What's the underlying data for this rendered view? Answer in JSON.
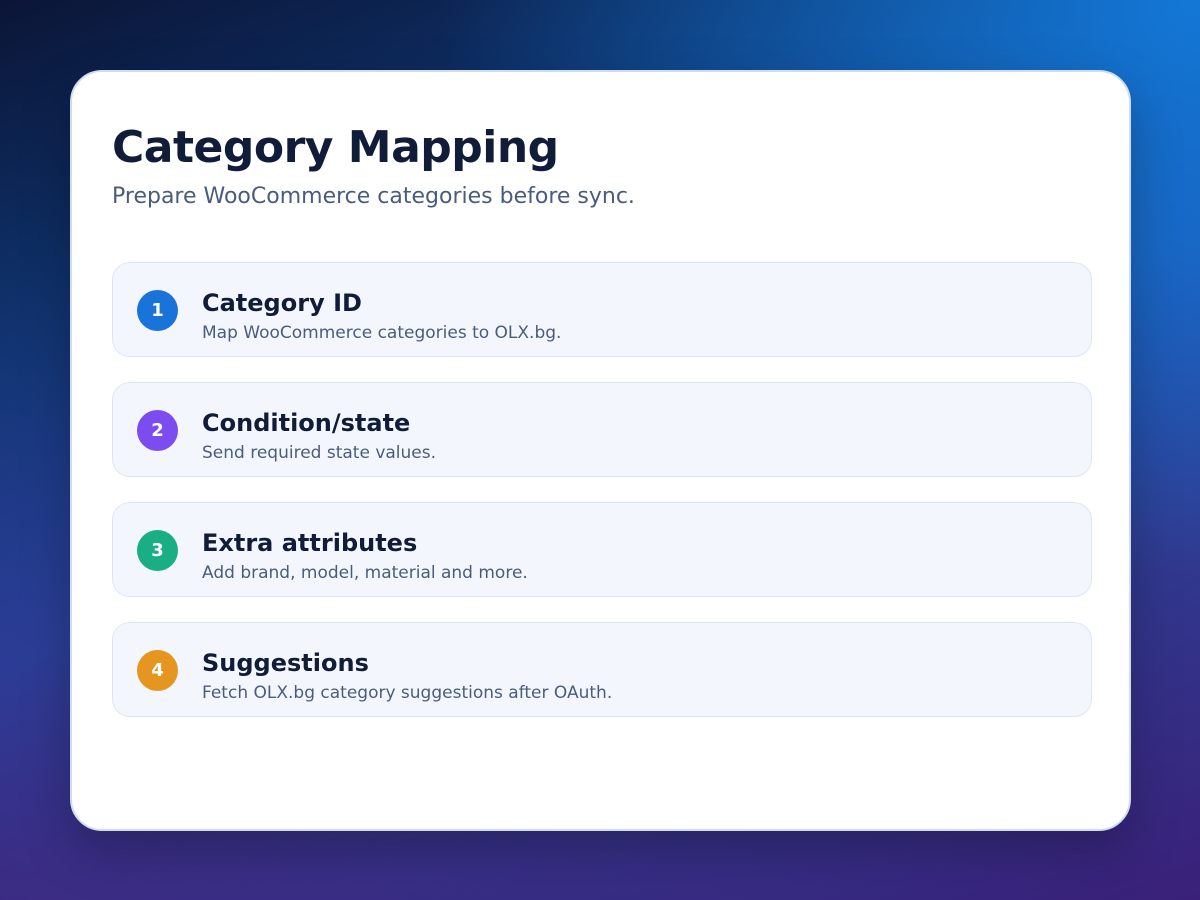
{
  "header": {
    "title": "Category Mapping",
    "subtitle": "Prepare WooCommerce categories before sync."
  },
  "steps": [
    {
      "number": "1",
      "title": "Category ID",
      "description": "Map WooCommerce categories to OLX.bg.",
      "color": "#1a73d9"
    },
    {
      "number": "2",
      "title": "Condition/state",
      "description": "Send required state values.",
      "color": "#7c4cf0"
    },
    {
      "number": "3",
      "title": "Extra attributes",
      "description": "Add brand, model, material and more.",
      "color": "#1aae84"
    },
    {
      "number": "4",
      "title": "Suggestions",
      "description": "Fetch OLX.bg category suggestions after OAuth.",
      "color": "#e59620"
    }
  ]
}
